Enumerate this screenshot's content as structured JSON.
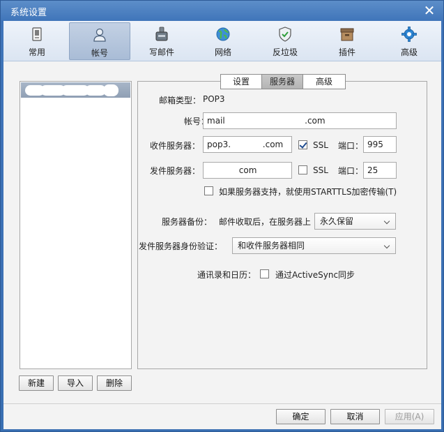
{
  "window": {
    "title": "系统设置",
    "close_glyph": "✕"
  },
  "toolbar": {
    "items": [
      {
        "label": "常用",
        "icon": "general-icon"
      },
      {
        "label": "帐号",
        "icon": "account-icon"
      },
      {
        "label": "写邮件",
        "icon": "compose-icon"
      },
      {
        "label": "网络",
        "icon": "network-icon"
      },
      {
        "label": "反垃圾",
        "icon": "antispam-icon"
      },
      {
        "label": "插件",
        "icon": "plugin-icon"
      },
      {
        "label": "高级",
        "icon": "advanced-icon"
      }
    ],
    "active_index": 1
  },
  "account_list": {
    "buttons": {
      "new": "新建",
      "import": "导入",
      "delete": "删除"
    }
  },
  "tabs": {
    "items": [
      "设置",
      "服务器",
      "高级"
    ],
    "active_index": 1
  },
  "server": {
    "mail_type_label": "邮箱类型：",
    "mail_type_value": "POP3",
    "account_label": "帐号：",
    "account_value": "mail                              .com",
    "incoming_label": "收件服务器：",
    "incoming_value": "pop3.            .com",
    "incoming_ssl_label": "SSL",
    "incoming_ssl_checked": true,
    "incoming_port_label": "端口：",
    "incoming_port_value": "995",
    "outgoing_label": "发件服务器：",
    "outgoing_value": "            com",
    "outgoing_ssl_label": "SSL",
    "outgoing_ssl_checked": false,
    "outgoing_port_label": "端口：",
    "outgoing_port_value": "25",
    "starttls_label": "如果服务器支持，就使用STARTTLS加密传输(T)",
    "starttls_checked": false,
    "backup_label": "服务器备份：",
    "backup_desc": "邮件收取后，在服务器上",
    "backup_value": "永久保留",
    "auth_label": "发件服务器身份验证：",
    "auth_value": "和收件服务器相同",
    "contacts_label": "通讯录和日历：",
    "activesync_label": "通过ActiveSync同步",
    "activesync_checked": false
  },
  "footer": {
    "ok": "确定",
    "cancel": "取消",
    "apply": "应用(A)"
  },
  "colors": {
    "titlebar": "#3f74b9",
    "selection": "#8f9fb4"
  }
}
